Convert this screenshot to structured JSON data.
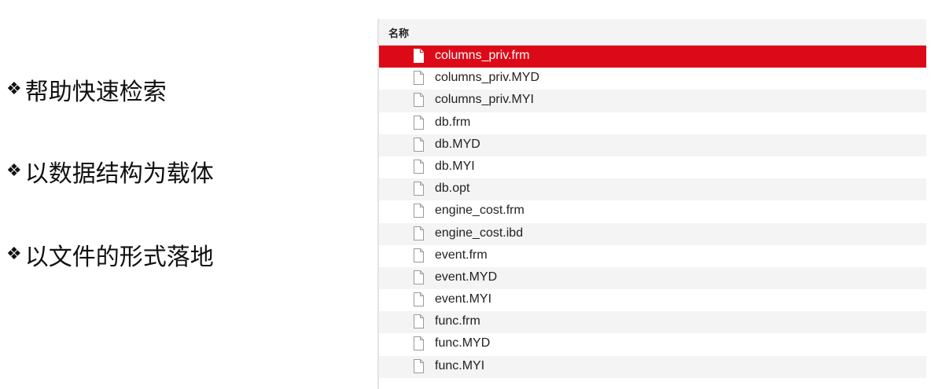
{
  "bullets": [
    {
      "marker": "❖",
      "text": "帮助快速检索"
    },
    {
      "marker": "❖",
      "text": "以数据结构为载体"
    },
    {
      "marker": "❖",
      "text": "以文件的形式落地"
    }
  ],
  "file_panel": {
    "column_header": "名称",
    "selected_color": "#dc0a18",
    "files": [
      {
        "name": "columns_priv.frm",
        "icon": "document-icon",
        "selected": true
      },
      {
        "name": "columns_priv.MYD",
        "icon": "document-icon",
        "selected": false
      },
      {
        "name": "columns_priv.MYI",
        "icon": "document-icon",
        "selected": false
      },
      {
        "name": "db.frm",
        "icon": "document-icon",
        "selected": false
      },
      {
        "name": "db.MYD",
        "icon": "document-icon",
        "selected": false
      },
      {
        "name": "db.MYI",
        "icon": "document-icon",
        "selected": false
      },
      {
        "name": "db.opt",
        "icon": "document-icon",
        "selected": false
      },
      {
        "name": "engine_cost.frm",
        "icon": "document-icon",
        "selected": false
      },
      {
        "name": "engine_cost.ibd",
        "icon": "document-icon",
        "selected": false
      },
      {
        "name": "event.frm",
        "icon": "document-icon",
        "selected": false
      },
      {
        "name": "event.MYD",
        "icon": "document-icon",
        "selected": false
      },
      {
        "name": "event.MYI",
        "icon": "document-icon",
        "selected": false
      },
      {
        "name": "func.frm",
        "icon": "document-icon",
        "selected": false
      },
      {
        "name": "func.MYD",
        "icon": "document-icon",
        "selected": false
      },
      {
        "name": "func.MYI",
        "icon": "document-icon",
        "selected": false
      }
    ]
  }
}
